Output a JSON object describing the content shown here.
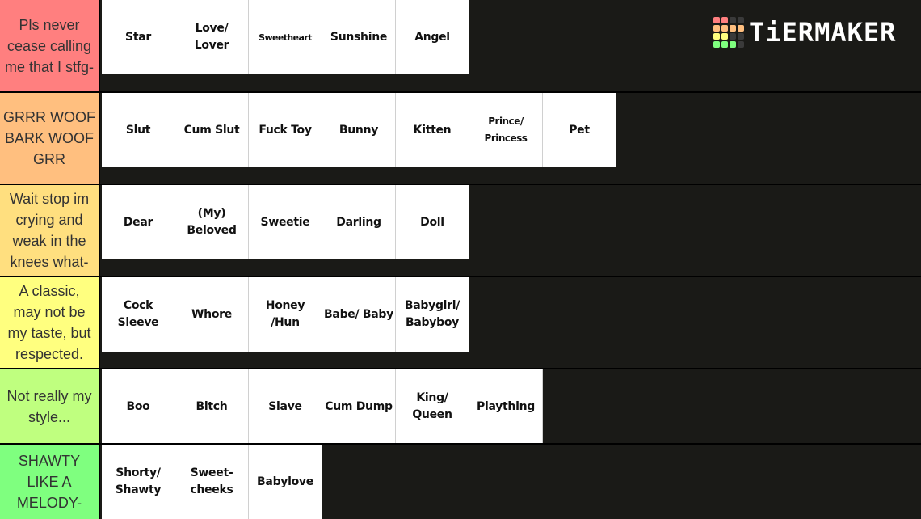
{
  "brand": {
    "name": "TiERMAKER",
    "logo_grid_colors": [
      "#ff7f7f",
      "#ff7f7f",
      "#3a3a3a",
      "#3a3a3a",
      "#ffbf7f",
      "#ffbf7f",
      "#ffbf7f",
      "#ffbf7f",
      "#ffff7f",
      "#ffff7f",
      "#3a3a3a",
      "#3a3a3a",
      "#7fff7f",
      "#7fff7f",
      "#7fff7f",
      "#3a3a3a"
    ]
  },
  "tiers": [
    {
      "label": "Pls never cease calling me that I stfg-",
      "color": "#ff7f7f",
      "items": [
        "Star",
        "Love/ Lover",
        "Sweetheart",
        "Sunshine",
        "Angel"
      ]
    },
    {
      "label": "GRRR WOOF BARK WOOF GRR",
      "color": "#ffbf7f",
      "items": [
        "Slut",
        "Cum Slut",
        "Fuck Toy",
        "Bunny",
        "Kitten",
        "Prince/ Princess",
        "Pet"
      ]
    },
    {
      "label": "Wait stop im crying and weak in the knees what-",
      "color": "#ffdf7f",
      "items": [
        "Dear",
        "(My) Beloved",
        "Sweetie",
        "Darling",
        "Doll"
      ]
    },
    {
      "label": "A classic, may not be my taste, but respected.",
      "color": "#ffff7f",
      "items": [
        "Cock Sleeve",
        "Whore",
        "Honey /Hun",
        "Babe/ Baby",
        "Babygirl/ Babyboy"
      ]
    },
    {
      "label": "Not really my style...",
      "color": "#bfff7f",
      "items": [
        "Boo",
        "Bitch",
        "Slave",
        "Cum Dump",
        "King/ Queen",
        "Plaything"
      ]
    },
    {
      "label": "SHAWTY LIKE A MELODY-",
      "color": "#7fff7f",
      "items": [
        "Shorty/ Shawty",
        "Sweet- cheeks",
        "Babylove"
      ]
    }
  ]
}
